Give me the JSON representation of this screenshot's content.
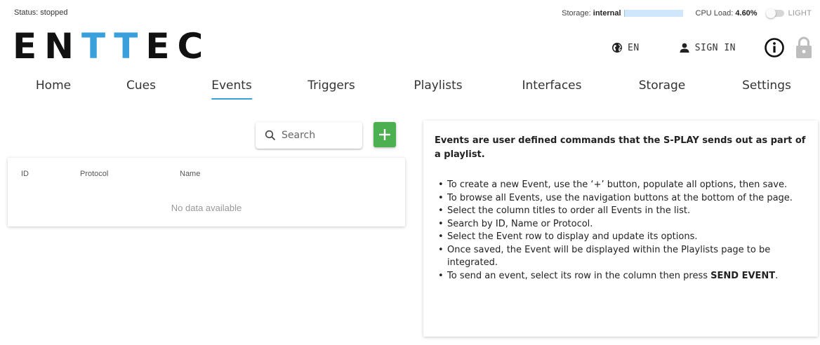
{
  "status": {
    "label": "Status: stopped",
    "storage_label": "Storage:",
    "storage_value": "internal",
    "cpu_label": "CPU Load:",
    "cpu_value": "4.60%",
    "theme_label": "LIGHT"
  },
  "logo": {
    "part1": "EN",
    "part2": "TT",
    "part3": "EC"
  },
  "header": {
    "language": "EN",
    "sign_in": "SIGN IN"
  },
  "nav": {
    "items": [
      "Home",
      "Cues",
      "Events",
      "Triggers",
      "Playlists",
      "Interfaces",
      "Storage",
      "Settings"
    ],
    "active": "Events"
  },
  "search": {
    "placeholder": "Search"
  },
  "table": {
    "columns": [
      "ID",
      "Protocol",
      "Name"
    ],
    "empty_text": "No data available"
  },
  "info": {
    "title": "Events are user defined commands that the S-PLAY sends out as part of a playlist.",
    "items": [
      "To create a new Event, use the ‘+’ button, populate all options, then save.",
      "To browse all Events, use the navigation buttons at the bottom of the page.",
      "Select the column titles to order all Events in the list.",
      "Search by ID, Name or Protocol.",
      "Select the Event row to display and update its options.",
      "Once saved, the Event will be displayed within the Playlists page to be integrated."
    ],
    "last_item_prefix": "To send an event, select its row in the column then press ",
    "last_item_bold": "SEND EVENT",
    "last_item_suffix": "."
  },
  "colors": {
    "brand_blue": "#3aa0db",
    "add_green": "#4caf50",
    "storage_bar": "#cfe6fb"
  },
  "icons": {
    "language": "globe-icon",
    "sign_in": "user-icon",
    "info": "info-icon",
    "lock": "lock-icon",
    "search": "search-icon",
    "add": "plus-icon"
  }
}
